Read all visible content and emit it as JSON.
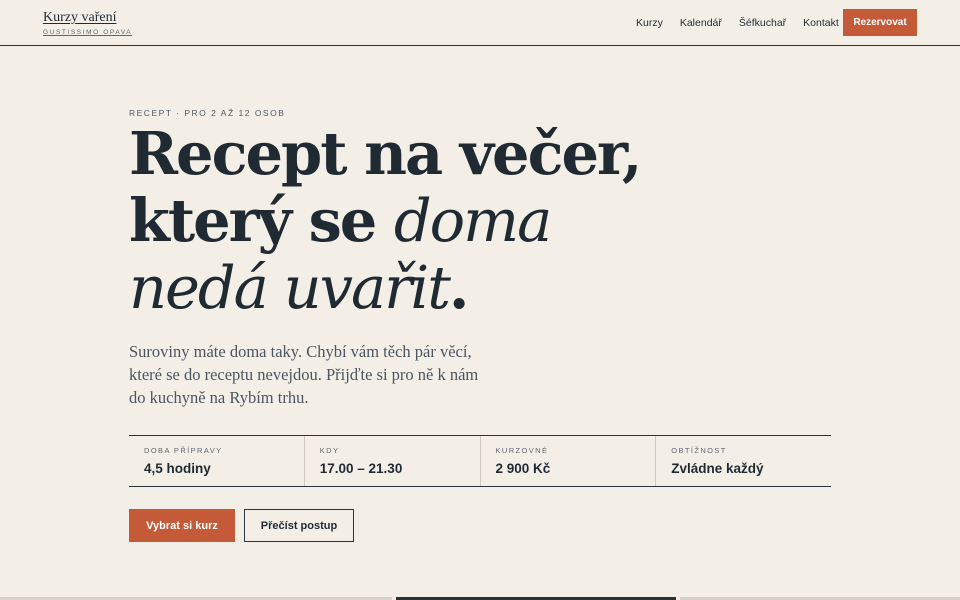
{
  "brand": {
    "name": "Kurzy vaření",
    "tagline": "GUSTISSIMO OPAVA"
  },
  "nav": {
    "items": [
      {
        "label": "Kurzy"
      },
      {
        "label": "Kalendář"
      },
      {
        "label": "Šéfkuchař"
      },
      {
        "label": "Kontakt"
      }
    ],
    "cta_label": "Rezervovat"
  },
  "hero": {
    "eyebrow": "RECEPT · PRO 2 AŽ 12 OSOB",
    "line1": "Recept na večer,",
    "line2_a": "který se",
    "line2_b": "doma",
    "line3": "nedá uvařit",
    "line3_end": ".",
    "lead": "Suroviny máte doma taky. Chybí vám těch pár věcí, které se do receptu nevejdou. Přijďte si pro ně k nám do kuchyně na Rybím trhu."
  },
  "facts": [
    {
      "label": "DOBA PŘÍPRAVY",
      "value": "4,5 hodiny"
    },
    {
      "label": "KDY",
      "value": "17.00 – 21.30"
    },
    {
      "label": "KURZOVNÉ",
      "value": "2 900 Kč"
    },
    {
      "label": "OBTÍŽNOST",
      "value": "Zvládne každý"
    }
  ],
  "actions": {
    "primary_label": "Vybrat si kurz",
    "secondary_label": "Přečíst postup"
  },
  "colors": {
    "background": "#f3efe7",
    "ink": "#1f2a33",
    "accent": "#c45a37"
  }
}
